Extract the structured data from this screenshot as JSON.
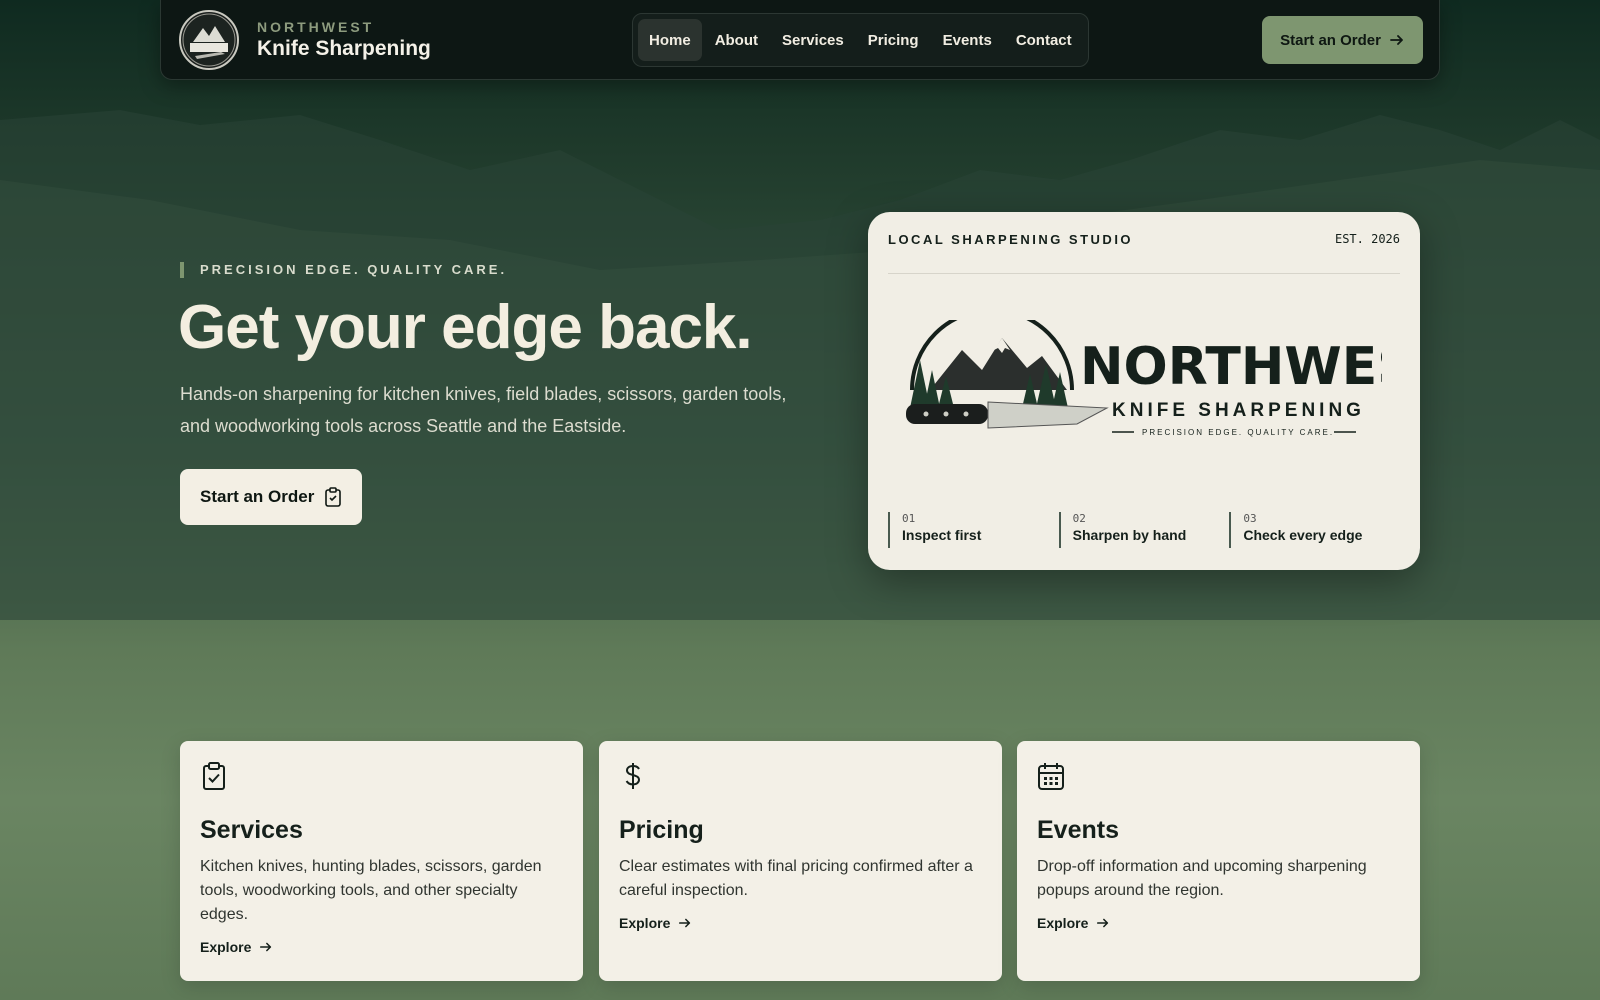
{
  "nav": {
    "brand_small": "NORTHWEST",
    "brand_big": "Knife Sharpening",
    "links": [
      "Home",
      "About",
      "Services",
      "Pricing",
      "Events",
      "Contact"
    ],
    "active": "Home",
    "cta": "Start an Order",
    "logo_text": "NORTHWEST"
  },
  "hero": {
    "eyebrow": "PRECISION EDGE. QUALITY CARE.",
    "title": "Get your edge back.",
    "subtitle": "Hands-on sharpening for kitchen knives, field blades, scissors, garden tools, and woodworking tools across Seattle and the Eastside.",
    "cta": "Start an Order"
  },
  "badge": {
    "studio": "LOCAL SHARPENING STUDIO",
    "est": "EST. 2026",
    "logo_title": "NORTHWEST",
    "logo_subtitle": "KNIFE SHARPENING",
    "logo_tagline": "PRECISION EDGE. QUALITY CARE.",
    "steps": [
      {
        "num": "01",
        "label": "Inspect first"
      },
      {
        "num": "02",
        "label": "Sharpen by hand"
      },
      {
        "num": "03",
        "label": "Check every edge"
      }
    ]
  },
  "cards": [
    {
      "title": "Services",
      "desc": "Kitchen knives, hunting blades, scissors, garden tools, woodworking tools, and other specialty edges.",
      "link": "Explore",
      "icon": "clipboard-check-icon"
    },
    {
      "title": "Pricing",
      "desc": "Clear estimates with final pricing confirmed after a careful inspection.",
      "link": "Explore",
      "icon": "dollar-icon"
    },
    {
      "title": "Events",
      "desc": "Drop-off information and upcoming sharpening popups around the region.",
      "link": "Explore",
      "icon": "calendar-icon"
    }
  ],
  "colors": {
    "accent": "#7e9670",
    "dark": "#0d1714",
    "cream": "#f1eee5"
  }
}
